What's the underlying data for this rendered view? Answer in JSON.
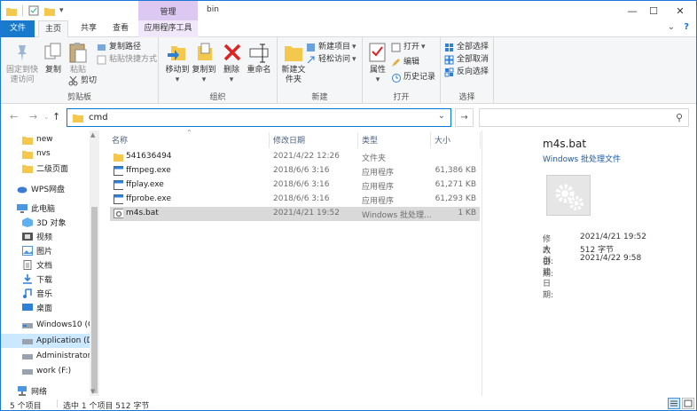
{
  "window": {
    "title": "bin",
    "context_tab_group": "管理",
    "controls": {
      "minimize": "—",
      "maximize": "☐",
      "close": "✕"
    }
  },
  "ribbon_tabs": [
    "文件",
    "主页",
    "共享",
    "查看",
    "应用程序工具"
  ],
  "ribbon_right": {
    "collapse": "⌄",
    "help": "?"
  },
  "ribbon": {
    "clipboard": {
      "label": "剪贴板",
      "pin": "固定到快速访问",
      "copy": "复制",
      "paste": "粘贴",
      "copy_path": "复制路径",
      "paste_shortcut": "粘贴快捷方式",
      "cut": "剪切"
    },
    "organize": {
      "label": "组织",
      "move_to": "移动到",
      "copy_to": "复制到",
      "delete": "删除",
      "rename": "重命名"
    },
    "new": {
      "label": "新建",
      "new_folder": "新建文件夹",
      "new_item": "新建项目",
      "easy_access": "轻松访问"
    },
    "open": {
      "label": "打开",
      "properties": "属性",
      "open": "打开",
      "edit": "编辑",
      "history": "历史记录"
    },
    "select": {
      "label": "选择",
      "select_all": "全部选择",
      "select_none": "全部取消",
      "invert": "反向选择"
    }
  },
  "address": {
    "path": "cmd",
    "back": "←",
    "forward": "→",
    "up": "↑",
    "dropdown": "⌄",
    "go": "→",
    "search_icon": "⚲"
  },
  "nav_pane": {
    "items": [
      {
        "label": "new",
        "icon": "folder-icon"
      },
      {
        "label": "nvs",
        "icon": "folder-icon"
      },
      {
        "label": "二级页面",
        "icon": "folder-icon"
      },
      {
        "label": "WPS网盘",
        "icon": "cloud-icon"
      },
      {
        "label": "此电脑",
        "icon": "computer-icon"
      },
      {
        "label": "3D 对象",
        "icon": "3d-objects-icon"
      },
      {
        "label": "视频",
        "icon": "video-icon"
      },
      {
        "label": "图片",
        "icon": "pictures-icon"
      },
      {
        "label": "文档",
        "icon": "documents-icon"
      },
      {
        "label": "下载",
        "icon": "downloads-icon"
      },
      {
        "label": "音乐",
        "icon": "music-icon"
      },
      {
        "label": "桌面",
        "icon": "desktop-icon"
      },
      {
        "label": "Windows10 (C:",
        "icon": "drive-icon"
      },
      {
        "label": "Application (D:",
        "icon": "drive-icon"
      },
      {
        "label": "Administrator (",
        "icon": "drive-icon"
      },
      {
        "label": "work (F:)",
        "icon": "drive-icon"
      },
      {
        "label": "网络",
        "icon": "network-icon"
      }
    ]
  },
  "file_list": {
    "columns": [
      "名称",
      "修改日期",
      "类型",
      "大小"
    ],
    "rows": [
      {
        "name": "541636494",
        "date": "2021/4/22 12:26",
        "type": "文件夹",
        "size": "",
        "icon": "folder-icon"
      },
      {
        "name": "ffmpeg.exe",
        "date": "2018/6/6 3:16",
        "type": "应用程序",
        "size": "61,386 KB",
        "icon": "exe-icon"
      },
      {
        "name": "ffplay.exe",
        "date": "2018/6/6 3:16",
        "type": "应用程序",
        "size": "61,271 KB",
        "icon": "exe-icon"
      },
      {
        "name": "ffprobe.exe",
        "date": "2018/6/6 3:16",
        "type": "应用程序",
        "size": "61,293 KB",
        "icon": "exe-icon"
      },
      {
        "name": "m4s.bat",
        "date": "2021/4/21 19:52",
        "type": "Windows 批处理...",
        "size": "1 KB",
        "icon": "bat-icon"
      }
    ]
  },
  "preview": {
    "name": "m4s.bat",
    "type": "Windows 批处理文件",
    "props": [
      {
        "k": "修改日期:",
        "v": "2021/4/21 19:52"
      },
      {
        "k": "大小:",
        "v": "512 字节"
      },
      {
        "k": "创建日期:",
        "v": "2021/4/22 9:58"
      }
    ]
  },
  "status": {
    "count": "5 个项目",
    "selected": "选中 1 个项目  512 字节"
  },
  "colors": {
    "accent": "#1979ca",
    "context_tab": "#dcc8f0",
    "selection": "#cce8ff",
    "row_selected": "#d9d9d9",
    "folder": "#f4c84d"
  }
}
